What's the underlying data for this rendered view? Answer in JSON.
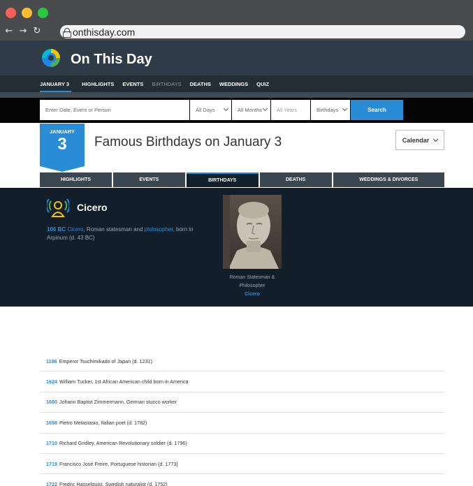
{
  "browser": {
    "url": "onthisday.com",
    "traffic_lights": [
      "#ff5f57",
      "#febc2e",
      "#28c840"
    ],
    "nav": {
      "back": "←",
      "forward": "→",
      "reload": "↻"
    }
  },
  "site": {
    "title": "On This Day",
    "accent": "#2a8cd6",
    "nav": [
      {
        "label": "JANUARY 3"
      },
      {
        "label": "HIGHLIGHTS"
      },
      {
        "label": "EVENTS"
      },
      {
        "label": "BIRTHDAYS"
      },
      {
        "label": "DEATHS"
      },
      {
        "label": "WEDDINGS"
      },
      {
        "label": "QUIZ"
      }
    ]
  },
  "search": {
    "placeholder": "Enter Date, Event or Person",
    "days": "All Days",
    "months": "All Months",
    "years_placeholder": "All Years",
    "category": "Birthdays",
    "button": "Search"
  },
  "date": {
    "month": "JANUARY",
    "day": "3"
  },
  "page_title": "Famous Birthdays on January 3",
  "calendar_button": "Calendar",
  "tabs": [
    "HIGHLIGHTS",
    "EVENTS",
    "BIRTHDAYS",
    "DEATHS",
    "WEDDINGS & DIVORCES"
  ],
  "featured": {
    "name": "Cicero",
    "year": "106 BC",
    "person_link": "Cicero",
    "desc_mid": ", Roman statesman and ",
    "role_link": "philosopher",
    "desc_end": ", born in Arpinum (d. 43 BC)",
    "caption_line1": "Roman Statesman &",
    "caption_line2": "Philosopher",
    "caption_name": "Cicero"
  },
  "entries": [
    {
      "year": "1196",
      "text": "Emperor Tsuchimikado of Japan (d. 1231)"
    },
    {
      "year": "1624",
      "text": "William Tucker, 1st African American child born in America"
    },
    {
      "year": "1680",
      "text": "Johann Baptist Zimmermann, German stucco worker"
    },
    {
      "year": "1698",
      "text": "Pietro Metastasio, Italian poet (d. 1782)"
    },
    {
      "year": "1710",
      "text": "Richard Gridley, American Revolutionary soldier (d. 1796)"
    },
    {
      "year": "1719",
      "text": "Francisco José Freire, Portuguese historian (d. 1773)"
    },
    {
      "year": "1722",
      "text": "Fredric Hasselquist, Swedish naturalist (d. 1752)"
    }
  ]
}
